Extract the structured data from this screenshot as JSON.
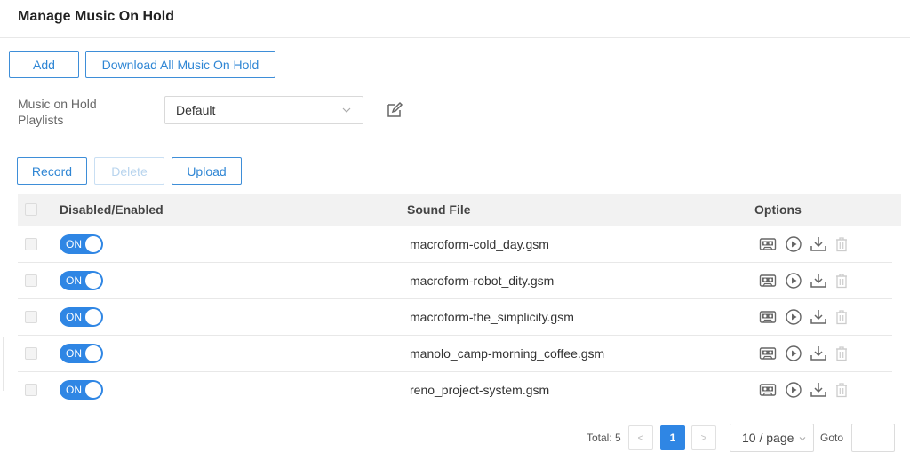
{
  "page": {
    "title": "Manage Music On Hold"
  },
  "toolbar": {
    "add_label": "Add",
    "download_all_label": "Download All Music On Hold"
  },
  "playlist": {
    "label": "Music on Hold Playlists",
    "selected": "Default"
  },
  "actions": {
    "record_label": "Record",
    "delete_label": "Delete",
    "upload_label": "Upload"
  },
  "table": {
    "headers": {
      "enabled": "Disabled/Enabled",
      "sound_file": "Sound File",
      "options": "Options"
    },
    "rows": [
      {
        "toggle": "ON",
        "file": "macroform-cold_day.gsm"
      },
      {
        "toggle": "ON",
        "file": "macroform-robot_dity.gsm"
      },
      {
        "toggle": "ON",
        "file": "macroform-the_simplicity.gsm"
      },
      {
        "toggle": "ON",
        "file": "manolo_camp-morning_coffee.gsm"
      },
      {
        "toggle": "ON",
        "file": "reno_project-system.gsm"
      }
    ],
    "option_icons": [
      "cassette-icon",
      "play-icon",
      "download-icon",
      "trash-icon"
    ]
  },
  "pagination": {
    "total": "Total: 5",
    "prev": "<",
    "current_page": "1",
    "next": ">",
    "page_size": "10 / page",
    "goto_label": "Goto"
  },
  "colors": {
    "accent": "#2f86e4",
    "border": "#3e8ed8",
    "header_bg": "#f2f2f2"
  }
}
